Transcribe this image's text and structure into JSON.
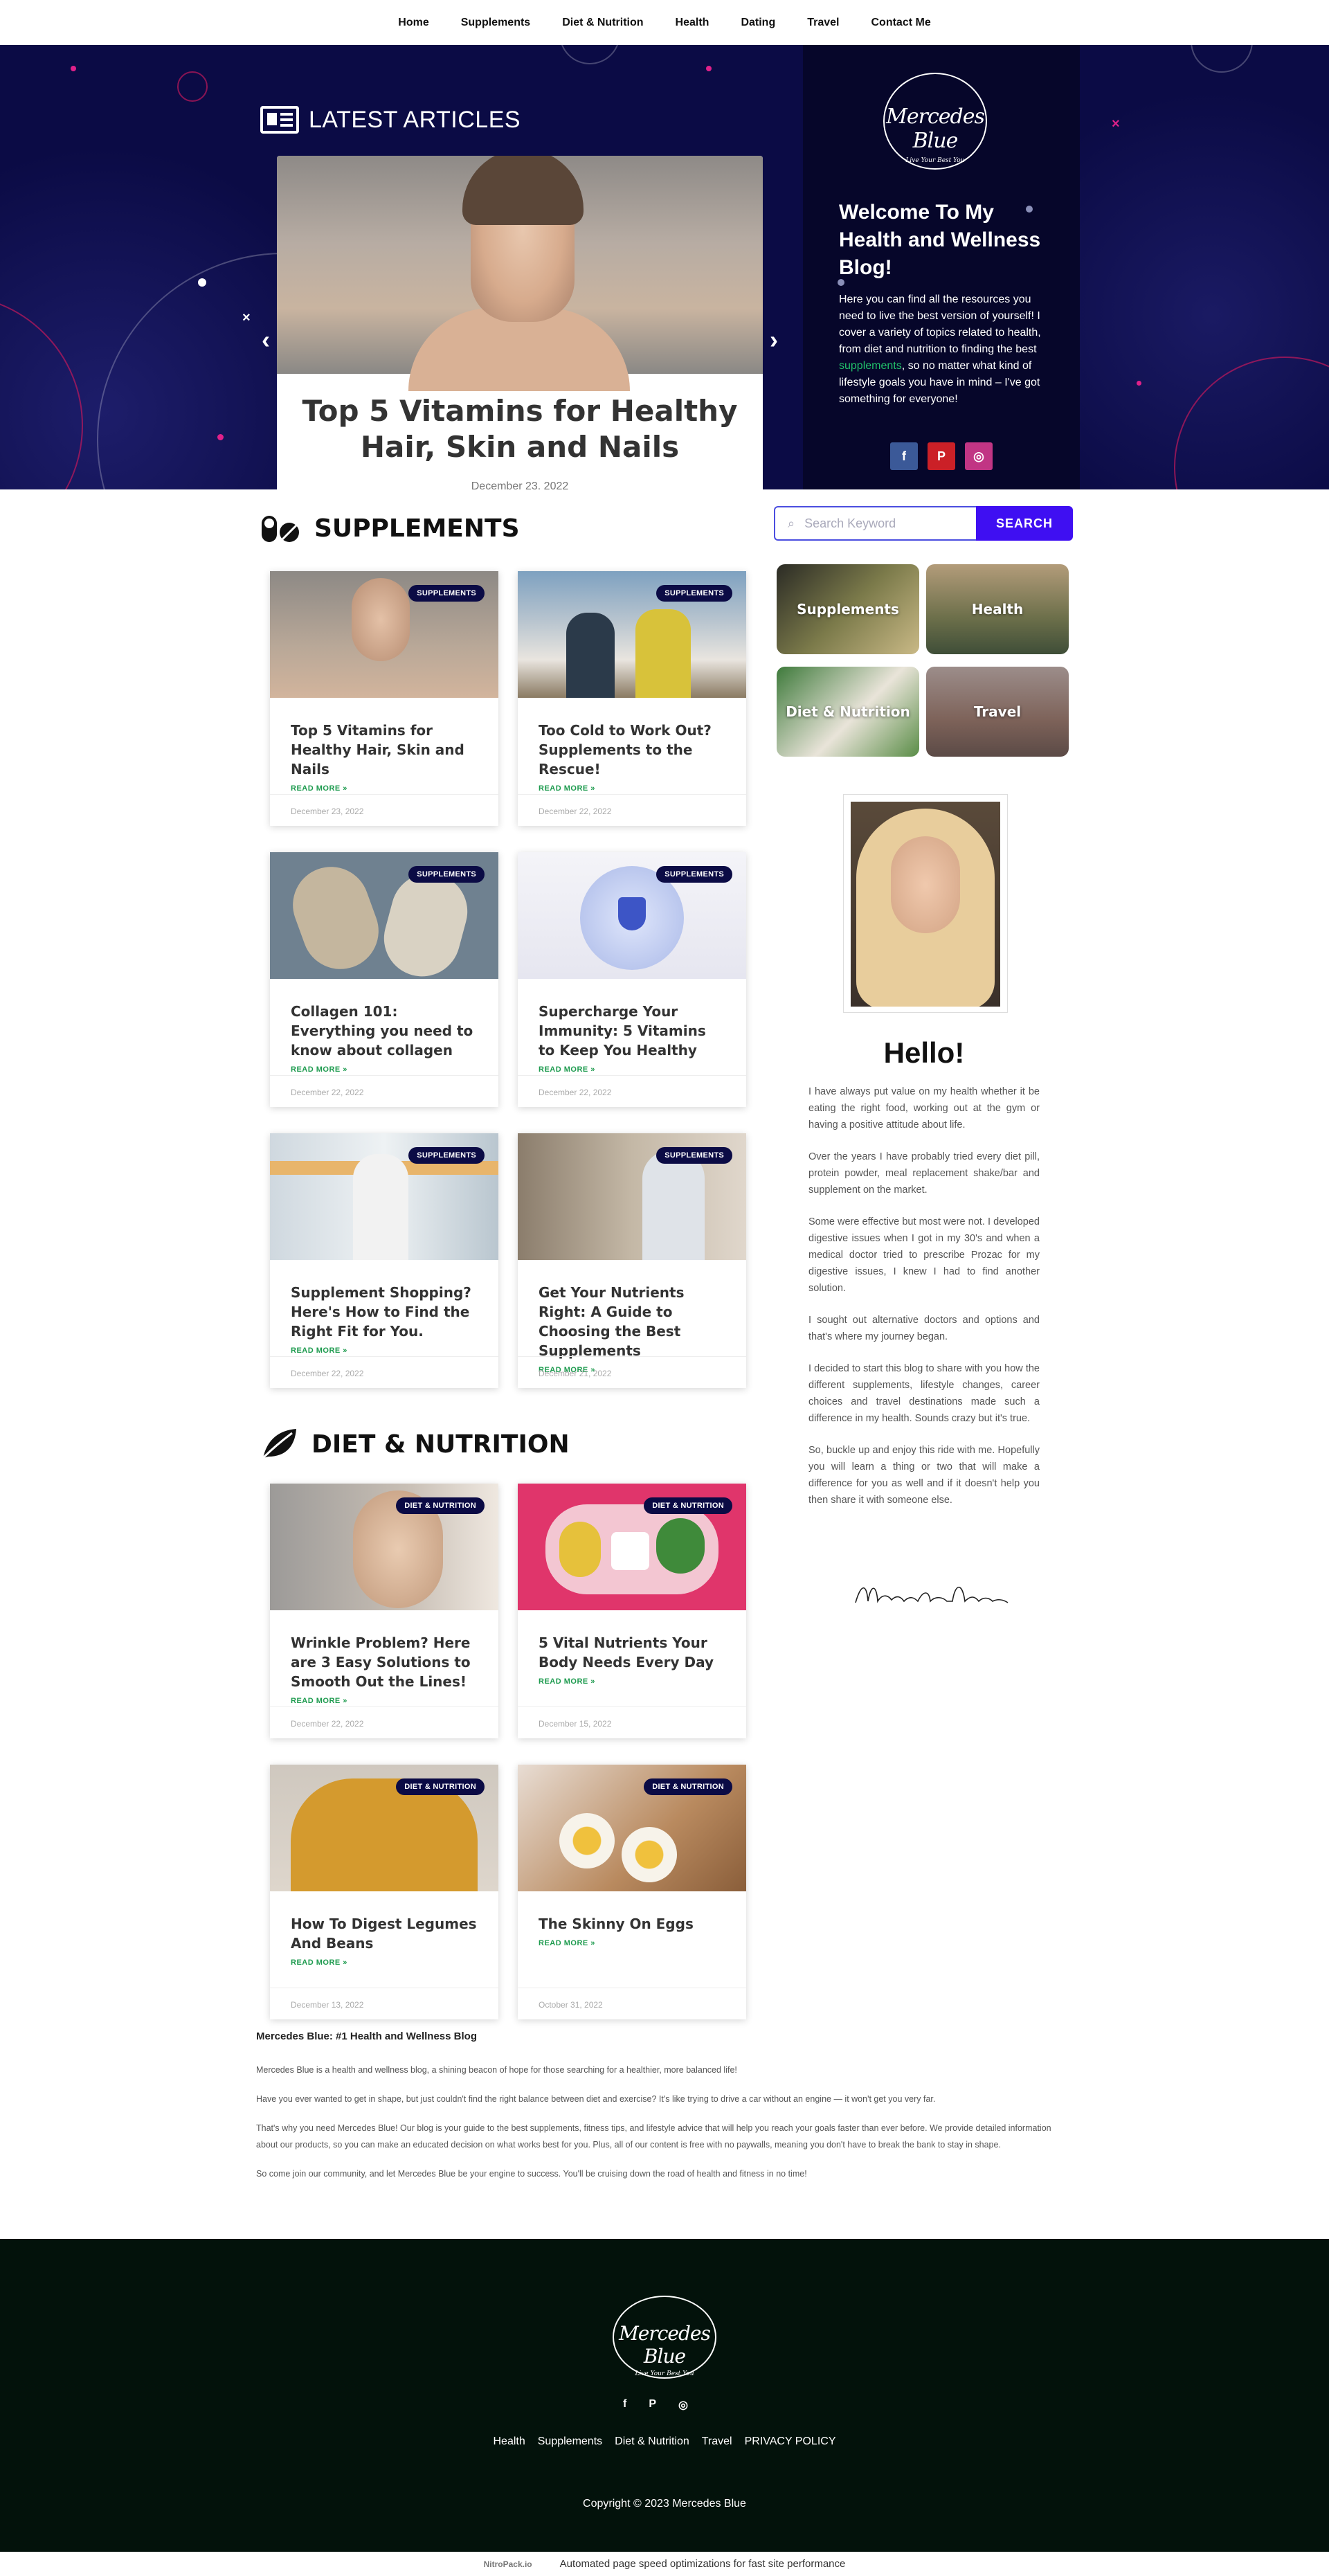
{
  "nav": [
    "Home",
    "Supplements",
    "Diet & Nutrition",
    "Health",
    "Dating",
    "Travel",
    "Contact Me"
  ],
  "hero": {
    "latest_title": "LATEST ARTICLES",
    "slide_title": "Top 5 Vitamins for Healthy Hair, Skin and Nails",
    "slide_date": "December 23, 2022",
    "prev": "‹",
    "next": "›"
  },
  "welcome": {
    "logo_name": "Mercedes Blue",
    "logo_tagline": "Live Your Best You",
    "heading": "Welcome To My Health and Wellness Blog!",
    "text_before": "Here you can find all the resources you need to live the best version of yourself! I cover a variety of topics related to health, from diet and nutrition to finding the best ",
    "link": "supplements",
    "text_after": ", so no matter what kind of lifestyle goals you have in mind – I've got something for everyone!",
    "socials": [
      {
        "name": "facebook",
        "glyph": "f",
        "color": "#3b5998"
      },
      {
        "name": "pinterest",
        "glyph": "P",
        "color": "#cb2027"
      },
      {
        "name": "instagram",
        "glyph": "◎",
        "color": "#c13584"
      }
    ]
  },
  "supplements": {
    "heading": "SUPPLEMENTS",
    "tag": "SUPPLEMENTS",
    "read_more": "READ MORE »",
    "cards": [
      {
        "title": "Top 5 Vitamins for Healthy Hair, Skin and Nails",
        "date": "December 23, 2022"
      },
      {
        "title": "Too Cold to Work Out? Supplements to the Rescue!",
        "date": "December 22, 2022"
      },
      {
        "title": "Collagen 101: Everything you need to know about collagen",
        "date": "December 22, 2022"
      },
      {
        "title": "Supercharge Your Immunity: 5 Vitamins to Keep You Healthy",
        "date": "December 22, 2022"
      },
      {
        "title": "Supplement Shopping? Here's How to Find the Right Fit for You.",
        "date": "December 22, 2022"
      },
      {
        "title": "Get Your Nutrients Right: A Guide to Choosing the Best Supplements",
        "date": "December 21, 2022"
      }
    ]
  },
  "diet": {
    "heading": "DIET & NUTRITION",
    "tag": "DIET & NUTRITION",
    "read_more": "READ MORE »",
    "cards": [
      {
        "title": "Wrinkle Problem? Here are 3 Easy Solutions to Smooth Out the Lines!",
        "date": "December 22, 2022"
      },
      {
        "title": "5 Vital Nutrients Your Body Needs Every Day",
        "date": "December 15, 2022"
      },
      {
        "title": "How To Digest Legumes And Beans",
        "date": "December 13, 2022"
      },
      {
        "title": "The Skinny On Eggs",
        "date": "October 31, 2022"
      }
    ]
  },
  "sidebar": {
    "search_placeholder": "Search Keyword",
    "search_button": "SEARCH",
    "tiles": [
      "Supplements",
      "Health",
      "Diet & Nutrition",
      "Travel"
    ],
    "hello": "Hello!",
    "bio": [
      "I have always put value on my health whether it be eating the right food, working out at the gym or having a positive attitude about life.",
      "Over the years I have probably tried every diet pill, protein powder, meal replacement shake/bar and supplement on the market.",
      "Some were effective but most were not. I developed digestive issues when I got in my 30's and when a medical doctor tried to prescribe Prozac for my digestive issues, I knew I had to find another solution.",
      "I sought out alternative doctors and options and that's where my journey began.",
      "I decided to start this blog to share with you how the different supplements, lifestyle changes, career choices and travel destinations made such a difference in my health. Sounds crazy but it's true.",
      "So, buckle up and enjoy this ride with me. Hopefully you will learn a thing or two that will make a difference for you as well and if it doesn't help you then share it with someone else."
    ],
    "signature": "Mercedes Blue"
  },
  "about": {
    "heading": "Mercedes Blue: #1 Health and Wellness Blog",
    "paras": [
      "Mercedes Blue is a health and wellness blog, a shining beacon of hope for those searching for a healthier, more balanced life!",
      "Have you ever wanted to get in shape, but just couldn't find the right balance between diet and exercise? It's like trying to drive a car without an engine — it won't get you very far.",
      "That's why you need Mercedes Blue! Our blog is your guide to the best supplements, fitness tips, and lifestyle advice that will help you reach your goals faster than ever before. We provide detailed information about our products, so you can make an educated decision on what works best for you. Plus, all of our content is free with no paywalls, meaning you don't have to break the bank to stay in shape.",
      "So come join our community, and let Mercedes Blue be your engine to success. You'll be cruising down the road of health and fitness in no time!"
    ]
  },
  "footer": {
    "logo_name": "Mercedes Blue",
    "logo_tagline": "Live Your Best You",
    "icons": [
      "f",
      "P",
      "◎"
    ],
    "links": [
      "Health",
      "Supplements",
      "Diet & Nutrition",
      "Travel",
      "PRIVACY POLICY"
    ],
    "copyright": "Copyright © 2023 Mercedes Blue"
  },
  "nitro": {
    "label": "NitroPack.io",
    "text": "Automated page speed optimizations for fast site performance"
  }
}
